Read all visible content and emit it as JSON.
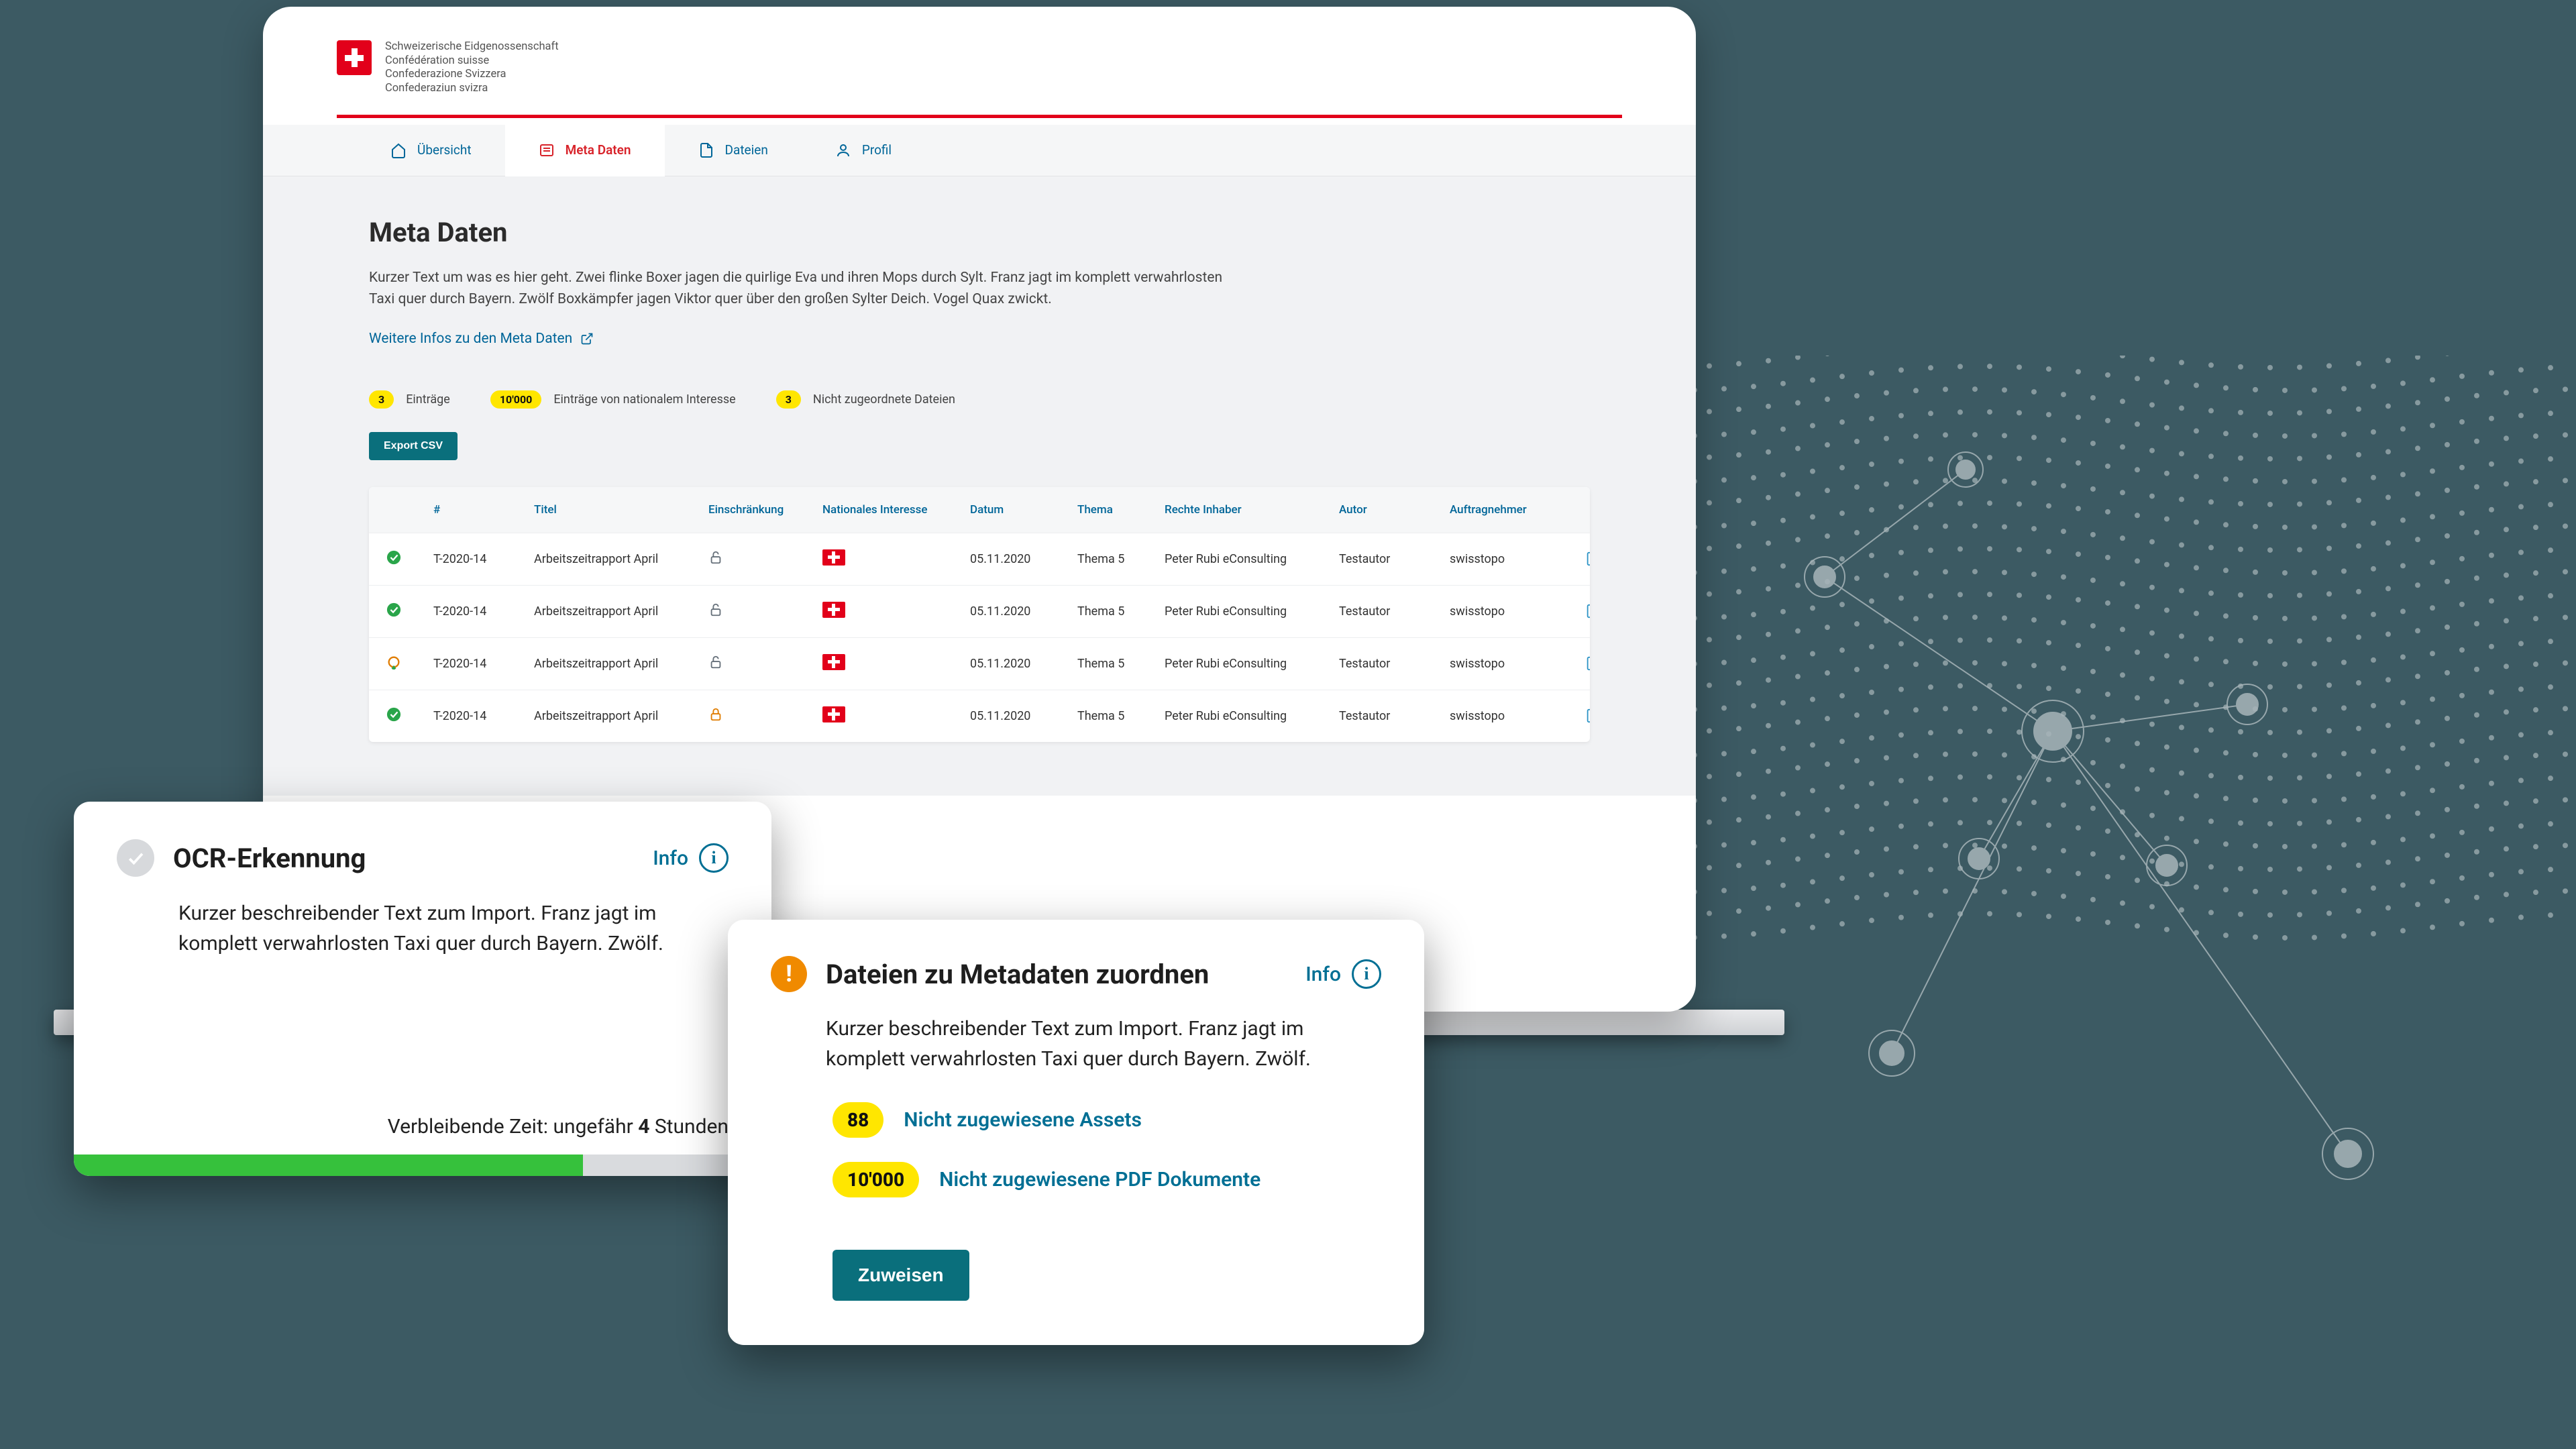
{
  "brand": {
    "line1": "Schweizerische Eidgenossenschaft",
    "line2": "Confédération suisse",
    "line3": "Confederazione Svizzera",
    "line4": "Confederaziun svizra"
  },
  "tabs": {
    "overview": "Übersicht",
    "metadata": "Meta Daten",
    "files": "Dateien",
    "profile": "Profil"
  },
  "page": {
    "title": "Meta Daten",
    "description": "Kurzer Text um was es hier geht. Zwei flinke Boxer jagen die quirlige Eva und ihren Mops durch Sylt. Franz jagt im komplett verwahrlosten Taxi quer durch Bayern. Zwölf Boxkämpfer jagen Viktor quer über den großen Sylter Deich. Vogel Quax zwickt.",
    "link": "Weitere Infos zu den Meta Daten"
  },
  "stats": {
    "entries_count": "3",
    "entries_label": "Einträge",
    "national_count": "10'000",
    "national_label": "Einträge von nationalem Interesse",
    "unassigned_count": "3",
    "unassigned_label": "Nicht zugeordnete Dateien"
  },
  "export_label": "Export CSV",
  "table": {
    "headers": {
      "num": "#",
      "titel": "Titel",
      "restriction": "Einschränkung",
      "national": "Nationales Interesse",
      "date": "Datum",
      "topic": "Thema",
      "rights": "Rechte Inhaber",
      "author": "Autor",
      "contractor": "Auftragnehmer"
    },
    "rows": [
      {
        "status": "ok",
        "num": "T-2020-14",
        "titel": "Arbeitszeitrapport April",
        "lock": "open",
        "date": "05.11.2020",
        "topic": "Thema 5",
        "rights": "Peter Rubi eConsulting",
        "author": "Testautor",
        "contractor": "swisstopo"
      },
      {
        "status": "ok",
        "num": "T-2020-14",
        "titel": "Arbeitszeitrapport April",
        "lock": "open",
        "date": "05.11.2020",
        "topic": "Thema 5",
        "rights": "Peter Rubi eConsulting",
        "author": "Testautor",
        "contractor": "swisstopo"
      },
      {
        "status": "warn",
        "num": "T-2020-14",
        "titel": "Arbeitszeitrapport April",
        "lock": "open",
        "date": "05.11.2020",
        "topic": "Thema 5",
        "rights": "Peter Rubi eConsulting",
        "author": "Testautor",
        "contractor": "swisstopo"
      },
      {
        "status": "ok",
        "num": "T-2020-14",
        "titel": "Arbeitszeitrapport April",
        "lock": "locked",
        "date": "05.11.2020",
        "topic": "Thema 5",
        "rights": "Peter Rubi eConsulting",
        "author": "Testautor",
        "contractor": "swisstopo"
      }
    ]
  },
  "ocr": {
    "title": "OCR-Erkennung",
    "info": "Info",
    "desc": "Kurzer beschreibender Text zum Import. Franz jagt im komplett verwahrlosten Taxi quer durch Bayern. Zwölf.",
    "time_prefix": "Verbleibende Zeit: ungefähr ",
    "time_value": "4",
    "time_suffix": " Stunden",
    "progress_pct": 73
  },
  "assign": {
    "title": "Dateien zu Metadaten zuordnen",
    "info": "Info",
    "desc": "Kurzer beschreibender Text zum Import. Franz jagt im komplett verwahrlosten Taxi quer durch Bayern. Zwölf.",
    "assets_count": "88",
    "assets_label": "Nicht zugewiesene Assets",
    "pdf_count": "10'000",
    "pdf_label": "Nicht zugewiesene PDF Dokumente",
    "button": "Zuweisen"
  }
}
